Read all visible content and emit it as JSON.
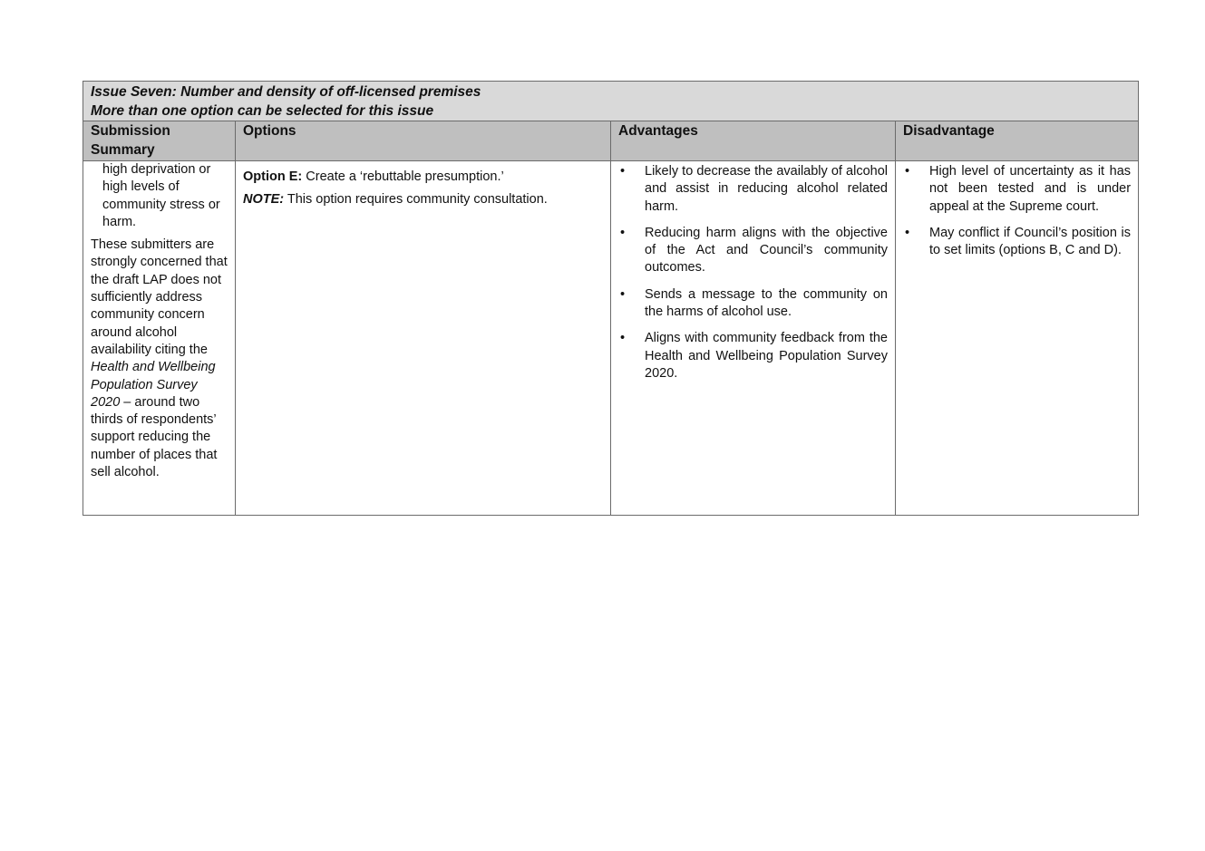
{
  "issue": {
    "title_line1": "Issue Seven: Number and density of off-licensed premises",
    "title_line2": "More than one option can be selected for this issue"
  },
  "columns": {
    "summary": "Submission Summary",
    "options": "Options",
    "advantages": "Advantages",
    "disadvantage": "Disadvantage"
  },
  "summary": {
    "continued_item": "high deprivation or high levels of community stress or harm.",
    "para_start": "These submitters are strongly concerned that the draft LAP does not sufficiently address community concern around alcohol availability citing the ",
    "para_italic": "Health and Wellbeing Population Survey 2020",
    "para_end": " – around two thirds of respondents’ support reducing the number of places that sell alcohol."
  },
  "options": {
    "option_label": "Option E:",
    "option_text": " Create a ‘rebuttable presumption.’",
    "note_label": "NOTE:",
    "note_text": " This option requires community consultation."
  },
  "advantages": [
    "Likely to decrease the availably of alcohol and assist in reducing alcohol related harm.",
    "Reducing harm aligns with the objective of the Act and Council’s community outcomes.",
    "Sends a message to the community on the harms of alcohol use.",
    "Aligns with community feedback from the Health and Wellbeing Population Survey 2020."
  ],
  "disadvantages": [
    "High level of uncertainty as it has not been tested and is under appeal at the Supreme court.",
    "May conflict if Council’s position is to set limits (options B, C and D)."
  ],
  "bullet_glyph": "•"
}
